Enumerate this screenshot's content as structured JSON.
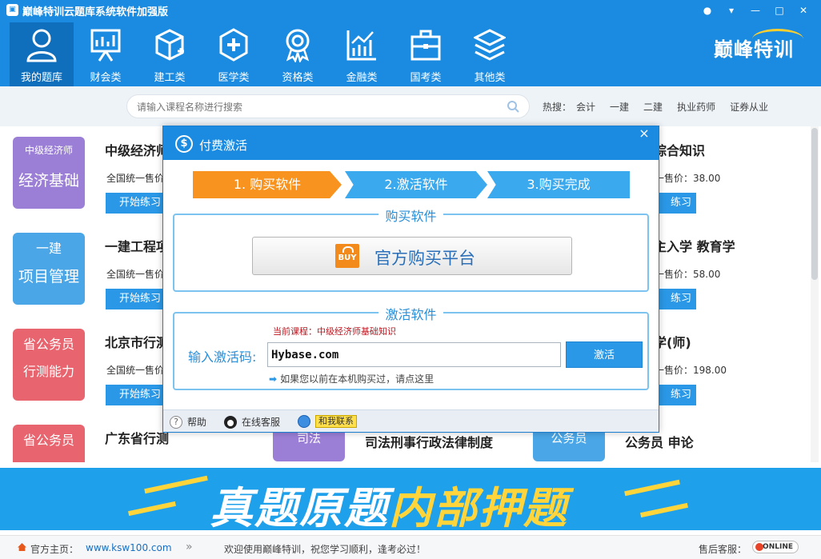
{
  "app": {
    "title": "巅峰特训云题库系统软件加强版",
    "brand": "巅峰特训"
  },
  "nav": [
    {
      "label": "我的题库",
      "icon": "user-icon"
    },
    {
      "label": "财会类",
      "icon": "chart-board-icon"
    },
    {
      "label": "建工类",
      "icon": "cube-icon"
    },
    {
      "label": "医学类",
      "icon": "medical-cross-icon"
    },
    {
      "label": "资格类",
      "icon": "medal-icon"
    },
    {
      "label": "金融类",
      "icon": "growth-chart-icon"
    },
    {
      "label": "国考类",
      "icon": "briefcase-icon"
    },
    {
      "label": "其他类",
      "icon": "layers-icon"
    }
  ],
  "search": {
    "placeholder": "请输入课程名称进行搜索",
    "hot_label": "热搜：",
    "hot_items": [
      "会计",
      "一建",
      "二建",
      "执业药师",
      "证券从业"
    ]
  },
  "courses": {
    "c1": {
      "badge_top": "中级经济师",
      "badge_main": "经济基础",
      "title": "中级经济师",
      "price": "全国统一售价",
      "button": "开始练习"
    },
    "c2": {
      "badge_top": "一建",
      "badge_main": "项目管理",
      "title": "一建工程项",
      "price": "全国统一售价",
      "button": "开始练习"
    },
    "c3": {
      "badge_top": "省公务员",
      "badge_main": "行测能力",
      "title": "北京市行测",
      "price": "全国统一售价",
      "button": "开始练习"
    },
    "c4": {
      "badge_top": "省公务员",
      "title": "广东省行测"
    },
    "r1": {
      "title": "综合知识",
      "price": "一售价：38.00",
      "button": "练习"
    },
    "r2": {
      "title": "主入学  教育学",
      "price": "一售价：58.00",
      "button": "练习"
    },
    "r3": {
      "title": "学(师)",
      "price": "一售价：198.00",
      "button": "练习"
    },
    "b4": {
      "badge_label": "司法",
      "title": "司法刑事行政法律制度"
    },
    "b5": {
      "badge_label": "公务员",
      "title": "公务员  申论"
    }
  },
  "banner": {
    "text_white": "真题原题",
    "text_yellow": "内部押题"
  },
  "statusbar": {
    "home_label": "官方主页：",
    "home_url": "www.ksw100.com",
    "arrows": "»",
    "welcome": "欢迎使用巅峰特训，祝您学习顺利，逢考必过！",
    "service_label": "售后客服：",
    "online": "ONLINE"
  },
  "modal": {
    "icon_glyph": "$",
    "title": "付费激活",
    "close": "×",
    "steps": [
      "1. 购买软件",
      "2.激活软件",
      "3.购买完成"
    ],
    "buy_section": "购买软件",
    "buy_icon_text": "BUY",
    "buy_button": "官方购买平台",
    "activate_section": "激活软件",
    "current_course": "当前课程：中级经济师基础知识",
    "code_label": "输入激活码:",
    "code_value": "Hybase.com",
    "activate_button": "激活",
    "hint": "如果您以前在本机购买过，请点这里",
    "footer": {
      "help": "帮助",
      "online_service": "在线客服",
      "contact": "和我联系"
    }
  },
  "colors": {
    "primary": "#1a8be0",
    "orange_step": "#f7931e",
    "button_blue": "#2a98e6",
    "badge_purple": "#9b7fd6",
    "badge_blue": "#4aa6e6",
    "badge_red": "#e8646e",
    "banner_yellow": "#ffd53b"
  }
}
